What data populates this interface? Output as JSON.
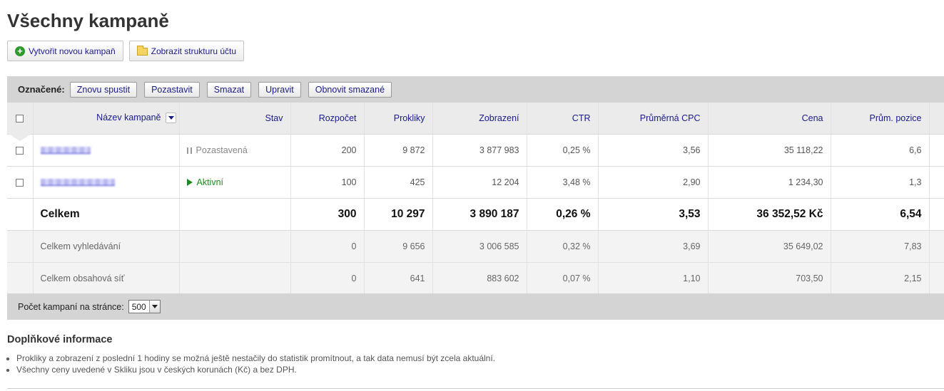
{
  "page": {
    "title": "Všechny kampaně"
  },
  "actions": {
    "create_label": "Vytvořit novou kampaň",
    "structure_label": "Zobrazit strukturu účtu"
  },
  "toolbar": {
    "label": "Označené:",
    "buttons": [
      "Znovu spustit",
      "Pozastavit",
      "Smazat",
      "Upravit",
      "Obnovit smazané"
    ]
  },
  "table": {
    "columns": [
      "Název kampaně",
      "Stav",
      "Rozpočet",
      "Prokliky",
      "Zobrazení",
      "CTR",
      "Průměrná CPC",
      "Cena",
      "Prům. pozice"
    ],
    "rows": [
      {
        "state": "Pozastavená",
        "state_type": "paused",
        "budget": "200",
        "clicks": "9 872",
        "impressions": "3 877 983",
        "ctr": "0,25 %",
        "cpc": "3,56",
        "cost": "35 118,22",
        "position": "6,6"
      },
      {
        "state": "Aktivní",
        "state_type": "active",
        "budget": "100",
        "clicks": "425",
        "impressions": "12 204",
        "ctr": "3,48 %",
        "cpc": "2,90",
        "cost": "1 234,30",
        "position": "1,3"
      }
    ],
    "total": {
      "label": "Celkem",
      "budget": "300",
      "clicks": "10 297",
      "impressions": "3 890 187",
      "ctr": "0,26 %",
      "cpc": "3,53",
      "cost": "36 352,52 Kč",
      "position": "6,54"
    },
    "search_total": {
      "label": "Celkem vyhledávání",
      "budget": "0",
      "clicks": "9 656",
      "impressions": "3 006 585",
      "ctr": "0,32 %",
      "cpc": "3,69",
      "cost": "35 649,02",
      "position": "7,83"
    },
    "content_total": {
      "label": "Celkem obsahová síť",
      "budget": "0",
      "clicks": "641",
      "impressions": "883 602",
      "ctr": "0,07 %",
      "cpc": "1,10",
      "cost": "703,50",
      "position": "2,15"
    }
  },
  "footer": {
    "per_page_label": "Počet kampaní na stránce:",
    "per_page_value": "500"
  },
  "info": {
    "title": "Doplňkové informace",
    "items": [
      "Prokliky a zobrazení z poslední 1 hodiny se možná ještě nestačily do statistik promítnout, a tak data nemusí být zcela aktuální.",
      "Všechny ceny uvedené v Skliku jsou v českých korunách (Kč) a bez DPH."
    ]
  },
  "icons": {
    "create": "plus-circle-icon",
    "structure": "folder-icon",
    "paused": "pause-icon",
    "active": "play-icon"
  },
  "colors": {
    "link": "#1a1a8c",
    "active": "#1e8a1e",
    "bar": "#d4d4d4"
  }
}
